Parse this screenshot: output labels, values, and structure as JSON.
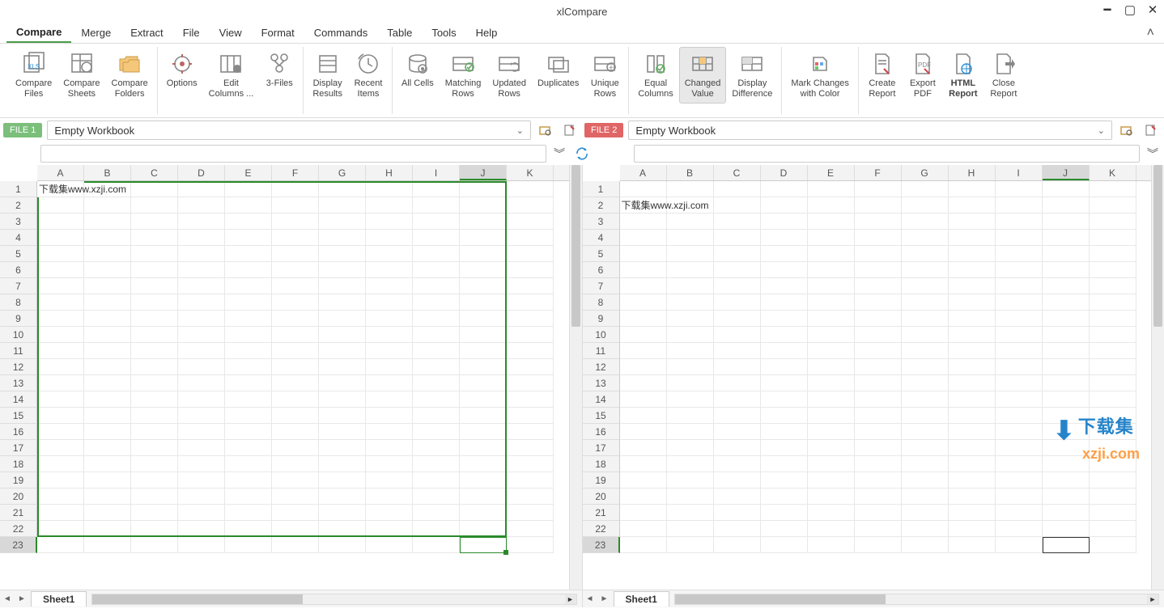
{
  "app": {
    "title": "xlCompare"
  },
  "menu": {
    "items": [
      "Compare",
      "Merge",
      "Extract",
      "File",
      "View",
      "Format",
      "Commands",
      "Table",
      "Tools",
      "Help"
    ],
    "active_index": 0
  },
  "ribbon": {
    "buttons": [
      {
        "id": "compare-files",
        "label": "Compare\nFiles"
      },
      {
        "id": "compare-sheets",
        "label": "Compare\nSheets"
      },
      {
        "id": "compare-folders",
        "label": "Compare\nFolders"
      },
      {
        "id": "options",
        "label": "Options"
      },
      {
        "id": "edit-columns",
        "label": "Edit\nColumns ..."
      },
      {
        "id": "three-files",
        "label": "3-Files"
      },
      {
        "id": "display-results",
        "label": "Display\nResults"
      },
      {
        "id": "recent-items",
        "label": "Recent\nItems"
      },
      {
        "id": "all-cells",
        "label": "All Cells"
      },
      {
        "id": "matching-rows",
        "label": "Matching\nRows"
      },
      {
        "id": "updated-rows",
        "label": "Updated\nRows"
      },
      {
        "id": "duplicates",
        "label": "Duplicates"
      },
      {
        "id": "unique-rows",
        "label": "Unique\nRows"
      },
      {
        "id": "equal-columns",
        "label": "Equal\nColumns"
      },
      {
        "id": "changed-value",
        "label": "Changed\nValue",
        "active": true
      },
      {
        "id": "display-difference",
        "label": "Display\nDifference"
      },
      {
        "id": "mark-changes",
        "label": "Mark Changes\nwith Color"
      },
      {
        "id": "create-report",
        "label": "Create\nReport"
      },
      {
        "id": "export-pdf",
        "label": "Export\nPDF"
      },
      {
        "id": "html-report",
        "label": "HTML\nReport",
        "bold": true
      },
      {
        "id": "close-report",
        "label": "Close\nReport"
      }
    ],
    "groups": [
      [
        0,
        1,
        2
      ],
      [
        3,
        4,
        5
      ],
      [
        6,
        7
      ],
      [
        8,
        9,
        10,
        11,
        12
      ],
      [
        13,
        14,
        15
      ],
      [
        16
      ],
      [
        17,
        18,
        19,
        20
      ]
    ]
  },
  "files": {
    "file1": {
      "badge": "FILE 1",
      "name": "Empty Workbook"
    },
    "file2": {
      "badge": "FILE 2",
      "name": "Empty Workbook"
    }
  },
  "grid": {
    "columns": [
      "A",
      "B",
      "C",
      "D",
      "E",
      "F",
      "G",
      "H",
      "I",
      "J",
      "K"
    ],
    "row_count": 23,
    "file1_sel_col": "J",
    "file2_sel_col": "J",
    "file1_cell": {
      "row": 1,
      "col": "A",
      "value": "下载集www.xzji.com"
    },
    "file2_cell": {
      "row": 2,
      "col": "A",
      "value": "下载集www.xzji.com"
    }
  },
  "tabs": {
    "sheet": "Sheet1"
  },
  "watermark": {
    "line1": "下载集",
    "line2": "xzji.com"
  }
}
